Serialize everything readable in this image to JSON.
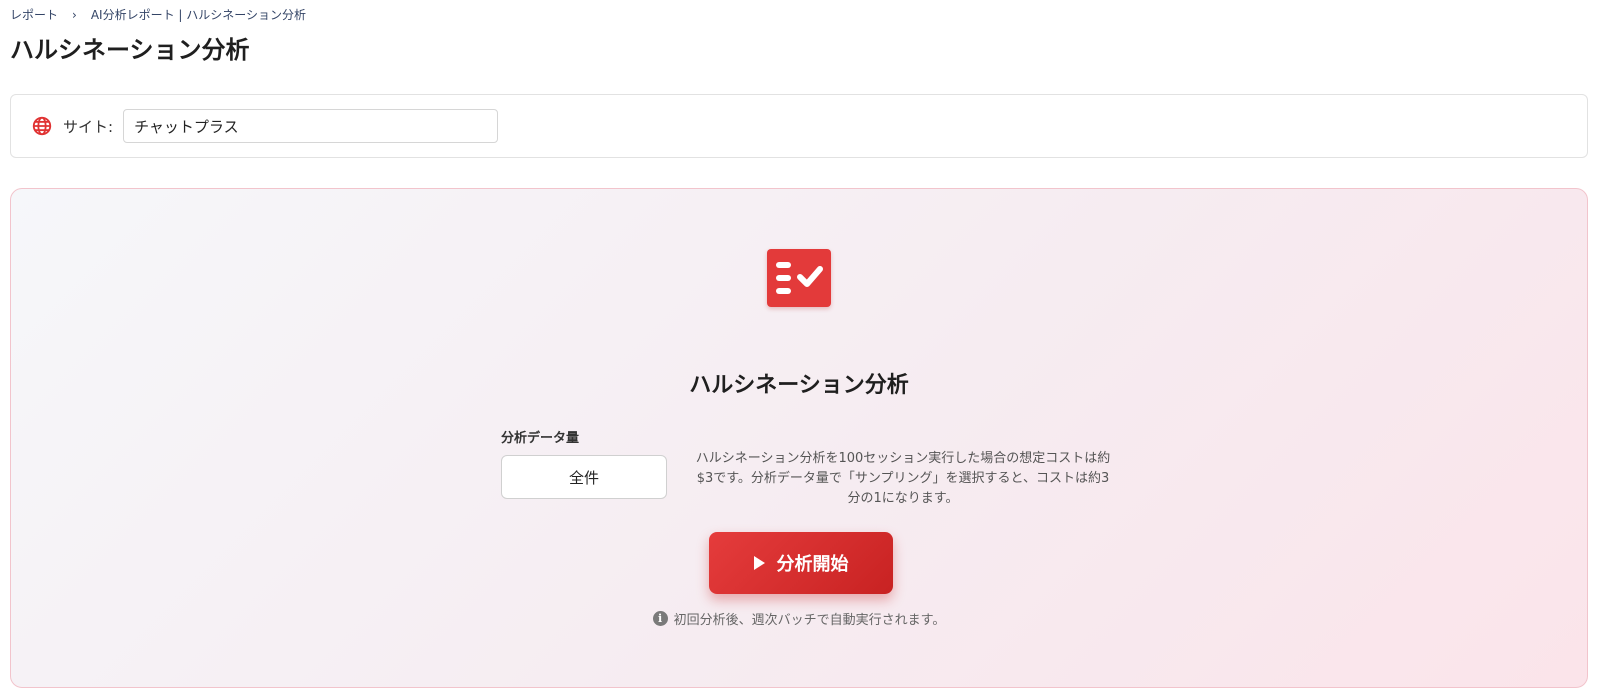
{
  "breadcrumb": {
    "items": [
      "レポート",
      "AI分析レポート | ハルシネーション分析"
    ],
    "separator": "›"
  },
  "page": {
    "title": "ハルシネーション分析"
  },
  "site": {
    "label": "サイト:",
    "value": "チャットプラス",
    "icon": "globe-icon"
  },
  "panel": {
    "icon": "checklist-icon",
    "title": "ハルシネーション分析",
    "volume_label": "分析データ量",
    "volume_value": "全件",
    "cost_note": "ハルシネーション分析を100セッション実行した場合の想定コストは約$3です。分析データ量で「サンプリング」を選択すると、コストは約3分の1になります。",
    "start_button": "分析開始",
    "footnote": "初回分析後、週次バッチで自動実行されます。"
  },
  "colors": {
    "accent": "#e33a3a",
    "panel_border": "#f2c4cc"
  }
}
